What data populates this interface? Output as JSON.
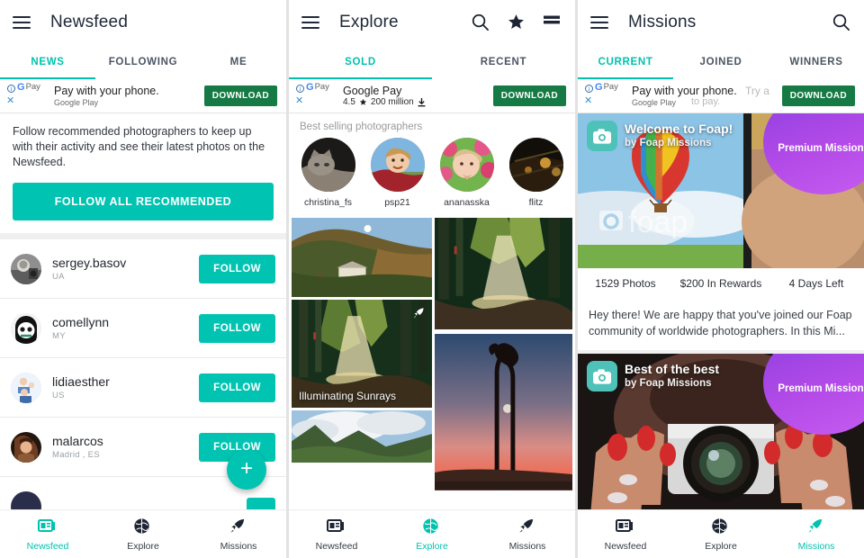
{
  "app": {
    "accent": "#00c4b1",
    "accent_text": "#00c2ad",
    "ad_button_green": "#157a43",
    "premium_purple": "#a84be6"
  },
  "newsfeed": {
    "title": "Newsfeed",
    "menu_icon": "hamburger-icon",
    "tabs": [
      {
        "label": "NEWS",
        "active": true
      },
      {
        "label": "FOLLOWING",
        "active": false
      },
      {
        "label": "ME",
        "active": false
      }
    ],
    "ad": {
      "info_icon": "i",
      "close_icon": "✕",
      "brand_g": "G",
      "brand_pay": "Pay",
      "headline": "Pay with your phone.",
      "subline": "Google Play",
      "button": "DOWNLOAD"
    },
    "promo": {
      "text": "Follow recommended photographers to keep up with their activity and see their latest photos on the Newsfeed.",
      "button": "FOLLOW ALL RECOMMENDED"
    },
    "users": [
      {
        "name": "sergey.basov",
        "location": "UA",
        "action": "FOLLOW"
      },
      {
        "name": "comellynn",
        "location": "MY",
        "action": "FOLLOW"
      },
      {
        "name": "lidiaesther",
        "location": "US",
        "action": "FOLLOW"
      },
      {
        "name": "malarcos",
        "location": "Madrid , ES",
        "action": "FOLLOW"
      }
    ],
    "fab": "+",
    "nav": [
      {
        "label": "Newsfeed",
        "icon": "newsfeed-icon",
        "active": true
      },
      {
        "label": "Explore",
        "icon": "globe-icon",
        "active": false
      },
      {
        "label": "Missions",
        "icon": "rocket-icon",
        "active": false
      }
    ]
  },
  "explore": {
    "title": "Explore",
    "menu_icon": "hamburger-icon",
    "actions": [
      "search-icon",
      "star-icon",
      "list-icon"
    ],
    "tabs": [
      {
        "label": "SOLD",
        "active": true
      },
      {
        "label": "RECENT",
        "active": false
      }
    ],
    "ad": {
      "info_icon": "i",
      "close_icon": "✕",
      "brand_g": "G",
      "brand_pay": "Pay",
      "headline": "Google Pay",
      "rating": "4.5",
      "installs": "200 million",
      "button": "DOWNLOAD"
    },
    "section_title": "Best selling photographers",
    "photographers": [
      {
        "name": "christina_fs"
      },
      {
        "name": "psp21"
      },
      {
        "name": "ananasska"
      },
      {
        "name": "flitz"
      }
    ],
    "photos": {
      "caption": "Illuminating Sunrays"
    },
    "nav": [
      {
        "label": "Newsfeed",
        "icon": "newsfeed-icon",
        "active": false
      },
      {
        "label": "Explore",
        "icon": "globe-icon",
        "active": true
      },
      {
        "label": "Missions",
        "icon": "rocket-icon",
        "active": false
      }
    ]
  },
  "missions": {
    "title": "Missions",
    "menu_icon": "hamburger-icon",
    "actions": [
      "search-icon"
    ],
    "tabs": [
      {
        "label": "CURRENT",
        "active": true
      },
      {
        "label": "JOINED",
        "active": false
      },
      {
        "label": "WINNERS",
        "active": false
      }
    ],
    "ad": {
      "info_icon": "i",
      "close_icon": "✕",
      "brand_g": "G",
      "brand_pay": "Pay",
      "headline": "Pay with your phone.",
      "subline": "Google Play",
      "ghost_headline": "Try a",
      "ghost_subline": "to pay.",
      "button": "DOWNLOAD"
    },
    "cards": [
      {
        "title": "Welcome to Foap!",
        "by": "by Foap Missions",
        "badge": "Premium Mission",
        "watermark": "foap",
        "stats": [
          "1529 Photos",
          "$200 In Rewards",
          "4 Days Left"
        ],
        "description": "Hey there! We are happy that you've joined our Foap community of worldwide photographers. In this Mi..."
      },
      {
        "title": "Best of the best",
        "by": "by Foap Missions",
        "badge": "Premium Mission"
      }
    ],
    "nav": [
      {
        "label": "Newsfeed",
        "icon": "newsfeed-icon",
        "active": false
      },
      {
        "label": "Explore",
        "icon": "globe-icon",
        "active": false
      },
      {
        "label": "Missions",
        "icon": "rocket-icon",
        "active": true
      }
    ]
  }
}
